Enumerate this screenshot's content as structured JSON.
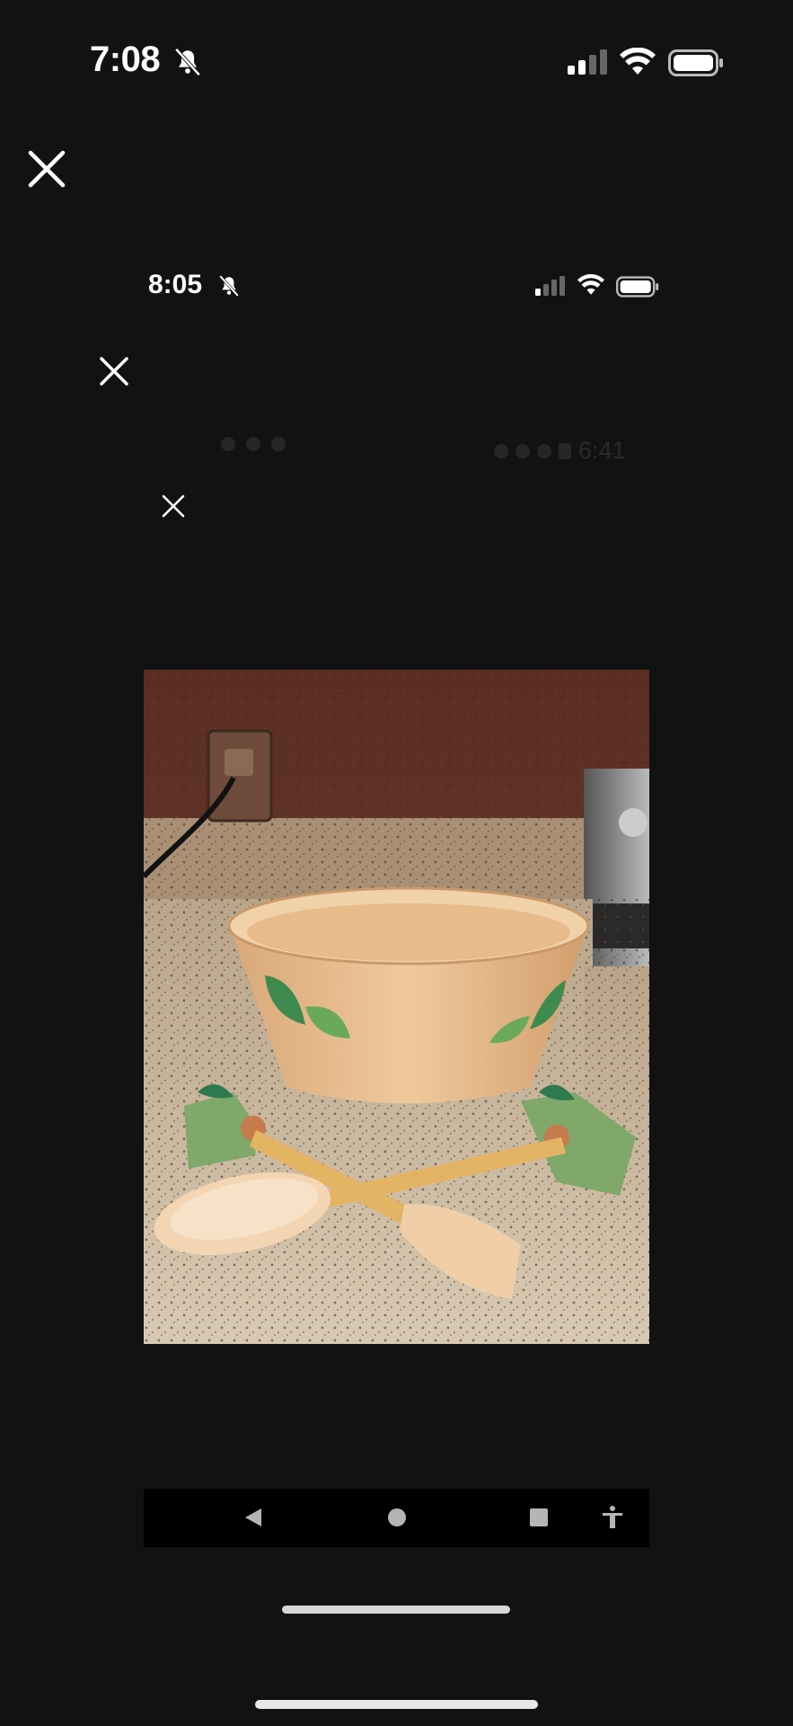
{
  "outer_status": {
    "time": "7:08"
  },
  "inner_status": {
    "time": "8:05"
  },
  "faint_status": {
    "time": "6:41"
  },
  "navbar": {
    "back": "back",
    "home": "home",
    "recents": "recents",
    "accessibility": "accessibility"
  },
  "colors": {
    "background": "#121212",
    "navbar": "#000000",
    "home_indicator": "#e8e8e8"
  },
  "icons": [
    "bell-slash-icon",
    "signal-icon",
    "wifi-icon",
    "battery-icon",
    "close-icon",
    "back-icon",
    "home-icon",
    "recents-icon",
    "accessibility-icon"
  ]
}
